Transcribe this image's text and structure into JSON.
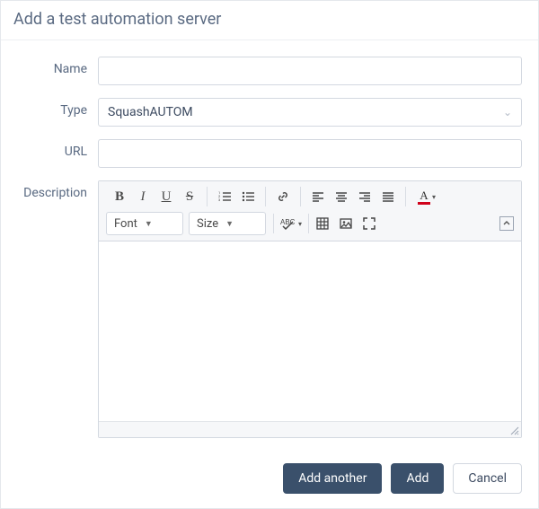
{
  "dialog": {
    "title": "Add a test automation server"
  },
  "form": {
    "name": {
      "label": "Name",
      "value": ""
    },
    "type": {
      "label": "Type",
      "value": "SquashAUTOM"
    },
    "url": {
      "label": "URL",
      "value": ""
    },
    "description": {
      "label": "Description"
    }
  },
  "editor": {
    "font_label": "Font",
    "size_label": "Size"
  },
  "actions": {
    "add_another": "Add another",
    "add": "Add",
    "cancel": "Cancel"
  }
}
